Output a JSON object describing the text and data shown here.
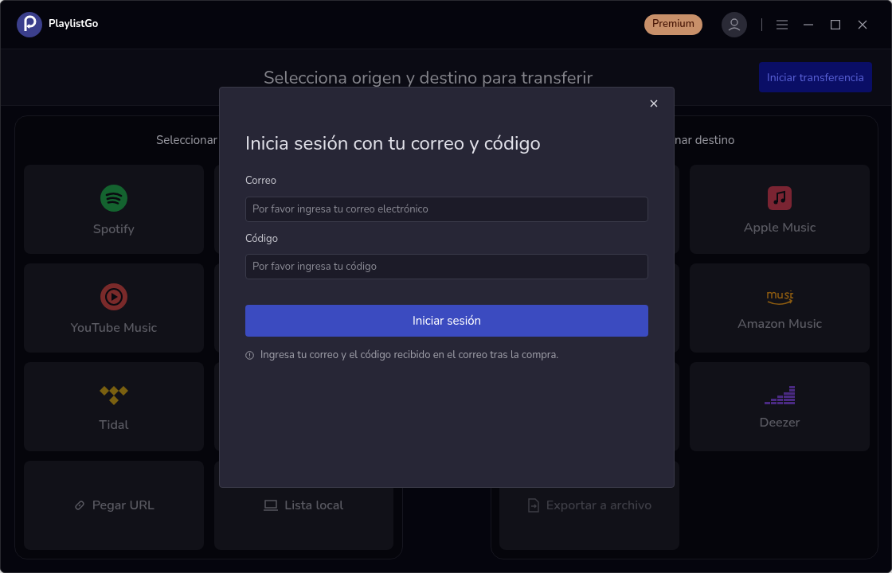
{
  "app": {
    "name": "PlaylistGo",
    "premium_badge": "Premium"
  },
  "header": {
    "title": "Selecciona origen y destino para transferir",
    "action": "Iniciar transferencia"
  },
  "source_panel": {
    "heading": "Seleccionar",
    "column_1": [
      {
        "label": "Spotify",
        "kind": "spotify"
      },
      {
        "label": "YouTube Music",
        "kind": "youtube"
      },
      {
        "label": "Tidal",
        "kind": "tidal"
      },
      {
        "label": "Pegar URL",
        "kind": "link"
      }
    ],
    "column_2": [
      {
        "label": "Lista local",
        "kind": "laptop"
      }
    ]
  },
  "destination_panel": {
    "heading": "nar destino",
    "column_1": [
      {
        "label": "Exportar a archivo",
        "kind": "export"
      }
    ],
    "column_2": [
      {
        "label": "Apple Music",
        "kind": "apple"
      },
      {
        "label": "Amazon Music",
        "kind": "amazon"
      },
      {
        "label": "Deezer",
        "kind": "deezer"
      }
    ]
  },
  "dialog": {
    "title": "Inicia sesión con tu correo y código",
    "fields": [
      {
        "label": "Correo",
        "placeholder": "Por favor ingresa tu correo electrónico"
      },
      {
        "label": "Código",
        "placeholder": "Por favor ingresa tu código"
      }
    ],
    "submit": "Iniciar sesión",
    "note": "Ingresa tu correo y el código recibido en el correo tras la compra."
  }
}
